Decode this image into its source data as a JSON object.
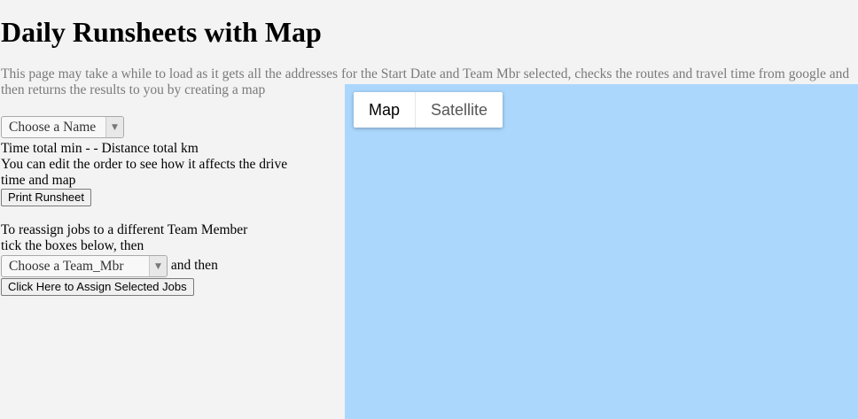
{
  "page": {
    "title": "Daily Runsheets with Map",
    "intro": "This page may take a while to load as it gets all the addresses for the Start Date and Team Mbr selected, checks the routes and travel time from google and then returns the results to you by creating a map"
  },
  "name_select": {
    "value": "Choose a Name",
    "arrow_icon": "triangle-down-icon"
  },
  "totals": {
    "text": "Time total  min - - Distance total  km"
  },
  "edit_hint": "You can edit the order to see how it affects the drive time and map",
  "print_button": "Print Runsheet",
  "reassign": {
    "line1": "To reassign jobs to a different Team Member",
    "line2": "tick the boxes below, then",
    "team_select_value": "Choose a Team_Mbr",
    "and_then": "and then",
    "assign_button": "Click Here to Assign Selected Jobs"
  },
  "map": {
    "background_color": "#abd7fd",
    "type_map": "Map",
    "type_satellite": "Satellite",
    "selected_type": "Map"
  }
}
